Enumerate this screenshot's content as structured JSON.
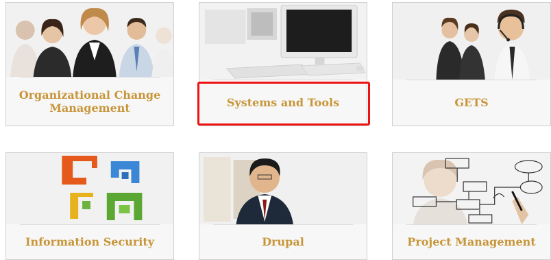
{
  "tiles": [
    {
      "label": "Organizational Change Management",
      "icon": "business-people-group-icon"
    },
    {
      "label": "Systems and Tools",
      "icon": "computer-workstation-icon"
    },
    {
      "label": "GETS",
      "icon": "call-center-agents-icon"
    },
    {
      "label": "Information Security",
      "icon": "office-logo-icon"
    },
    {
      "label": "Drupal",
      "icon": "smiling-businessman-icon"
    },
    {
      "label": "Project Management",
      "icon": "flowchart-drawing-icon"
    }
  ],
  "highlight": {
    "target": "Systems and Tools",
    "color": "#ee1111"
  },
  "colors": {
    "label": "#c8963a",
    "border": "#cfcfcf",
    "tile_bg": "#f7f7f7"
  }
}
